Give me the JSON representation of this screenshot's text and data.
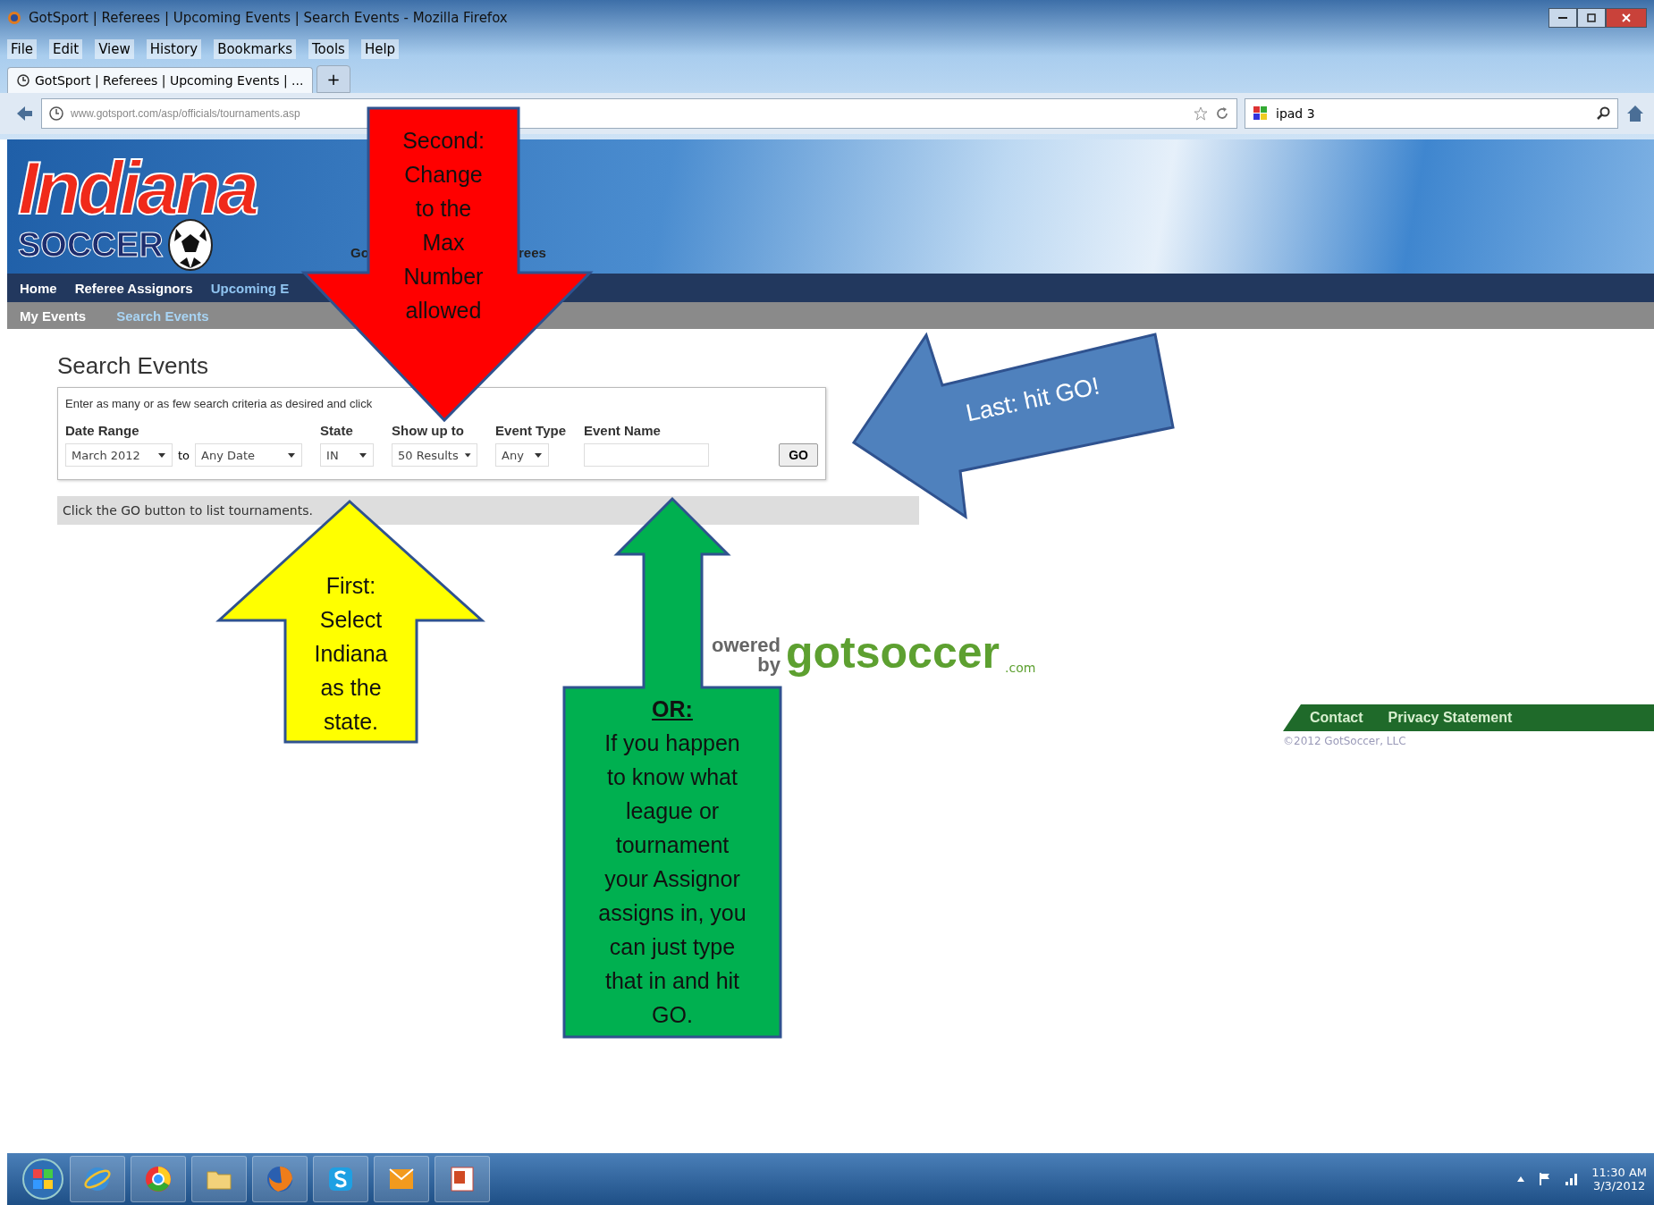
{
  "browser": {
    "title": "GotSport | Referees | Upcoming Events | Search Events - Mozilla Firefox",
    "menu": [
      "File",
      "Edit",
      "View",
      "History",
      "Bookmarks",
      "Tools",
      "Help"
    ],
    "tabs": [
      {
        "label": "GotSport | Referees | Upcoming Events | ...",
        "selected": true
      }
    ],
    "new_tab": "+",
    "url": "www.gotsport.com/asp/officials/tournaments.asp",
    "search": {
      "value": "ipad 3"
    }
  },
  "site": {
    "logo": {
      "line1": "Indiana",
      "line2": "SOCCER"
    },
    "banner_fragments": [
      "Go",
      "rees"
    ],
    "nav": [
      {
        "label": "Home",
        "selected": false
      },
      {
        "label": "Referee Assignors",
        "selected": false
      },
      {
        "label": "Upcoming E",
        "selected": true
      }
    ],
    "subnav": [
      {
        "label": "My Events",
        "selected": false
      },
      {
        "label": "Search Events",
        "selected": true
      }
    ]
  },
  "search_events": {
    "title": "Search Events",
    "intro": "Enter as many or as few search criteria as desired and click",
    "fields": [
      {
        "label": "Date Range",
        "kind": "range",
        "from": "March 2012",
        "joiner": "to",
        "to": "Any Date"
      },
      {
        "label": "State",
        "kind": "select",
        "value": "IN"
      },
      {
        "label": "Show up to",
        "kind": "select",
        "value": "50 Results"
      },
      {
        "label": "Event Type",
        "kind": "select",
        "value": "Any"
      },
      {
        "label": "Event Name",
        "kind": "text"
      }
    ],
    "go_button": "GO",
    "message": "Click the GO button to list tournaments."
  },
  "powered_by": {
    "prefix": "owered",
    "by": "by",
    "brand": "gotsoccer",
    "suffix": ".com"
  },
  "footer": {
    "links": [
      "Contact",
      "Privacy Statement"
    ],
    "copyright": "©2012 GotSoccer, LLC"
  },
  "callouts": [
    {
      "kind": "down",
      "color": "#ff0000",
      "lines": [
        "Second:",
        "Change",
        "to the",
        "Max",
        "Number",
        "allowed"
      ]
    },
    {
      "kind": "left",
      "color": "#4f81bd",
      "lines": [
        "Last:  hit GO!"
      ]
    },
    {
      "kind": "up",
      "color": "#ffff00",
      "lines": [
        "First:",
        "Select",
        "Indiana",
        "as the",
        "state."
      ]
    },
    {
      "kind": "up-box",
      "color": "#00b050",
      "heading": "OR:",
      "lines": [
        "If you happen",
        "to know what",
        "league or",
        "tournament",
        "your Assignor",
        "assigns in, you",
        "can just type",
        "that in and hit",
        "GO."
      ]
    }
  ],
  "taskbar": {
    "time": "11:30 AM",
    "date": "3/3/2012"
  }
}
